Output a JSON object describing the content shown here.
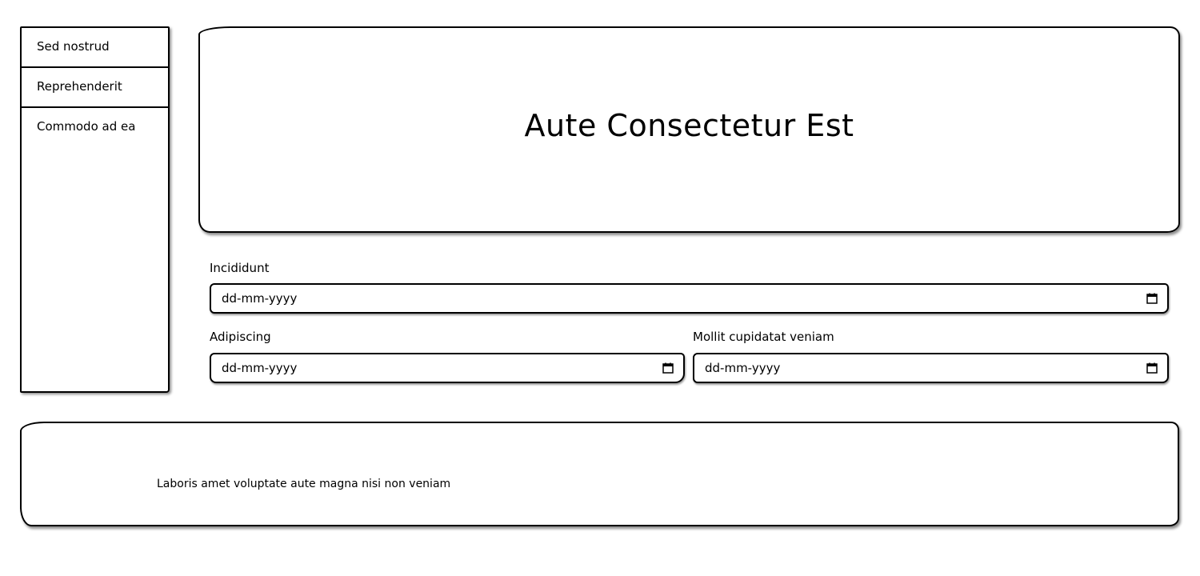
{
  "sidebar": {
    "items": [
      {
        "label": "Sed nostrud"
      },
      {
        "label": "Reprehenderit"
      },
      {
        "label": "Commodo ad ea"
      }
    ]
  },
  "hero": {
    "title": "Aute Consectetur Est"
  },
  "form": {
    "field1": {
      "label": "Incididunt",
      "placeholder": "dd-mm-yyyy"
    },
    "field2": {
      "label": "Adipiscing",
      "placeholder": "dd-mm-yyyy"
    },
    "field3": {
      "label": "Mollit cupidatat veniam",
      "placeholder": "dd-mm-yyyy"
    }
  },
  "footer": {
    "text": "Laboris amet voluptate aute magna nisi non veniam"
  },
  "icons": {
    "date_picker": "calendar-icon"
  }
}
